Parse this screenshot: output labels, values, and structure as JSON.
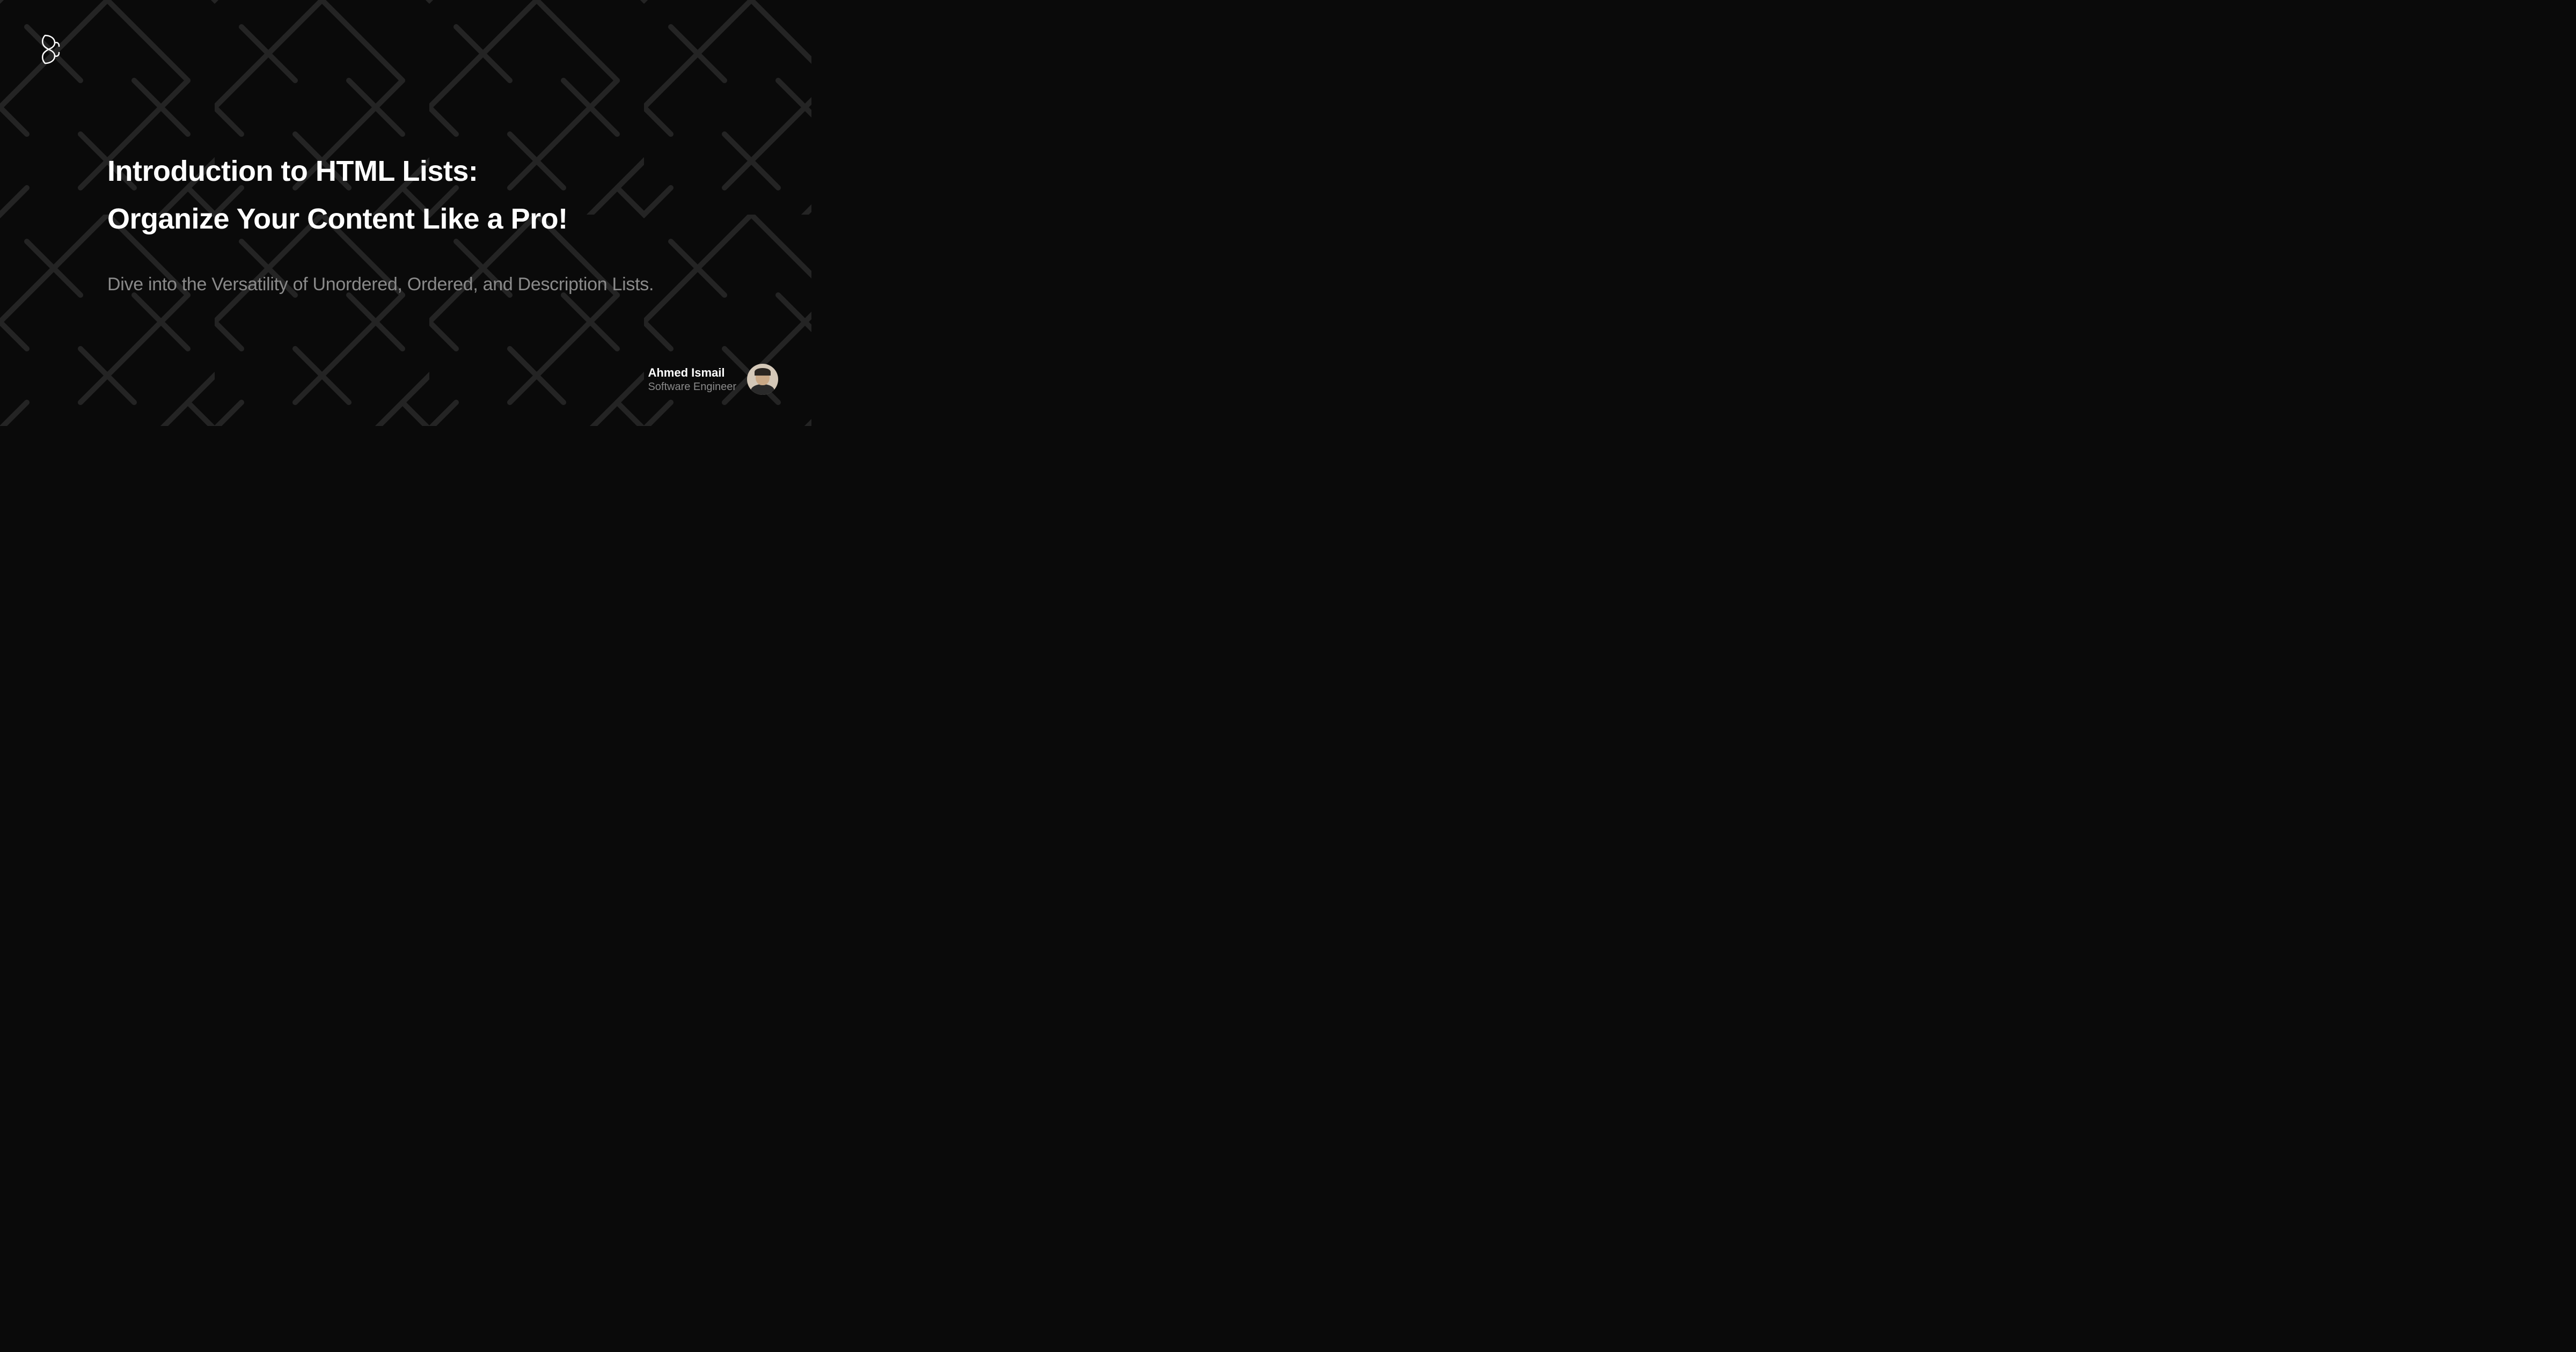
{
  "title_line1": "Introduction to HTML Lists:",
  "title_line2": "Organize Your Content Like a Pro!",
  "subtitle": "Dive into the Versatility of Unordered, Ordered, and Description Lists.",
  "author": {
    "name": "Ahmed Ismail",
    "role": "Software Engineer"
  }
}
